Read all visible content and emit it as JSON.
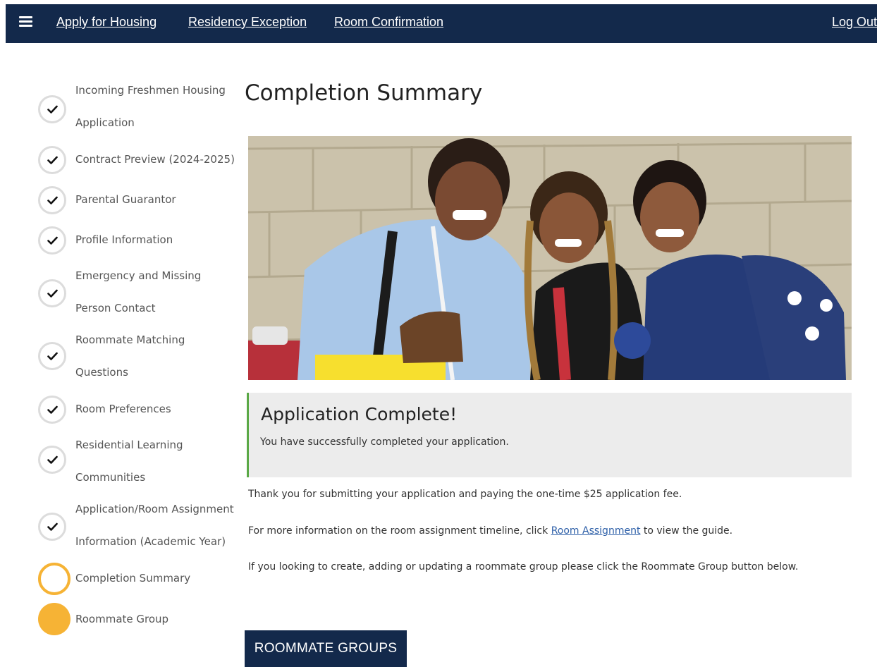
{
  "nav": {
    "links": [
      "Apply for Housing",
      "Residency Exception",
      "Room Confirmation"
    ],
    "logout": "Log Out"
  },
  "steps": [
    {
      "lines": [
        "Incoming Freshmen Housing",
        "Application"
      ],
      "status": "complete"
    },
    {
      "lines": [
        "Contract Preview (2024-2025)"
      ],
      "status": "complete"
    },
    {
      "lines": [
        "Parental Guarantor"
      ],
      "status": "complete"
    },
    {
      "lines": [
        "Profile Information"
      ],
      "status": "complete"
    },
    {
      "lines": [
        "Emergency and Missing",
        "Person Contact"
      ],
      "status": "complete"
    },
    {
      "lines": [
        "Roommate Matching",
        "Questions"
      ],
      "status": "complete"
    },
    {
      "lines": [
        "Room Preferences"
      ],
      "status": "complete"
    },
    {
      "lines": [
        "Residential Learning",
        "Communities"
      ],
      "status": "complete"
    },
    {
      "lines": [
        "Application/Room Assignment",
        "Information (Academic Year)"
      ],
      "status": "complete"
    },
    {
      "lines": [
        "Completion Summary"
      ],
      "status": "current"
    },
    {
      "lines": [
        "Roommate Group"
      ],
      "status": "upcoming"
    }
  ],
  "main": {
    "title": "Completion Summary",
    "notice": {
      "title": "Application Complete!",
      "text": "You have successfully completed your application."
    },
    "para1": "Thank you for submitting your application and paying the one-time $25 application fee.",
    "para2_before": "For more information on the room assignment timeline, click",
    "para2_link": "Room Assignment",
    "para2_after": "to view the guide.",
    "para3": "If you looking to create, adding or updating a roommate group please click the Roommate Group button below.",
    "button": "ROOMMATE GROUPS"
  },
  "colors": {
    "navy": "#13294b",
    "accent_orange": "#f6b335",
    "success_green": "#5aa846",
    "link_blue": "#2d5fa8"
  }
}
